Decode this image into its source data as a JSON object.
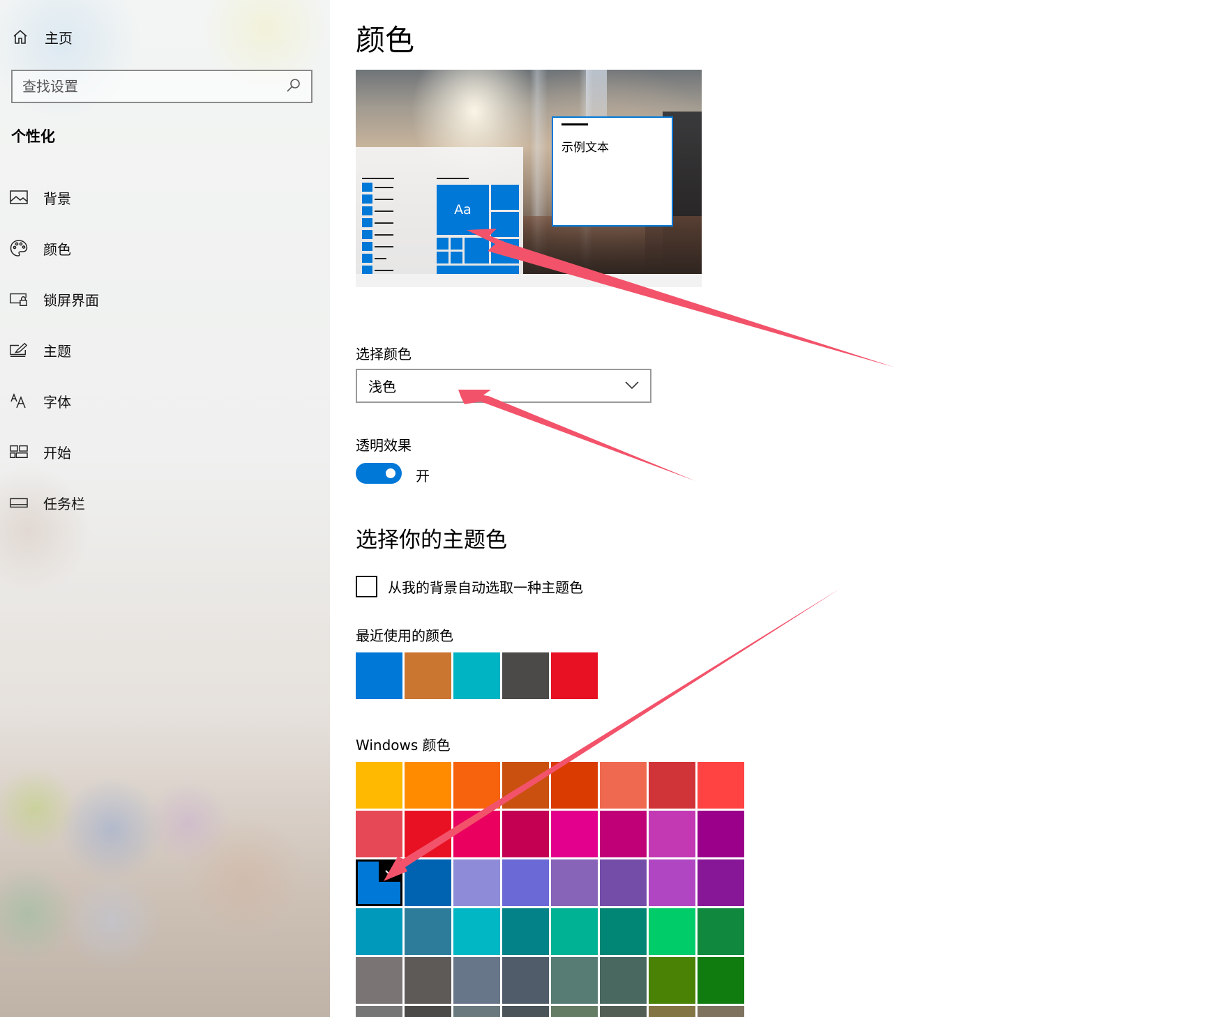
{
  "sidebar": {
    "home_label": "主页",
    "search_placeholder": "查找设置",
    "section_heading": "个性化",
    "items": [
      {
        "label": "背景",
        "icon": "picture-icon"
      },
      {
        "label": "颜色",
        "icon": "palette-icon"
      },
      {
        "label": "锁屏界面",
        "icon": "lock-screen-icon"
      },
      {
        "label": "主题",
        "icon": "theme-brush-icon"
      },
      {
        "label": "字体",
        "icon": "font-icon"
      },
      {
        "label": "开始",
        "icon": "start-tiles-icon"
      },
      {
        "label": "任务栏",
        "icon": "taskbar-icon"
      }
    ]
  },
  "main": {
    "title": "颜色",
    "preview": {
      "tile_label": "Aa",
      "sample_text": "示例文本"
    },
    "choose_color_label": "选择颜色",
    "choose_color_value": "浅色",
    "transparency_label": "透明效果",
    "transparency_state": "开",
    "transparency_on": true,
    "accent_heading": "选择你的主题色",
    "auto_pick_label": "从我的背景自动选取一种主题色",
    "auto_pick_checked": false,
    "recent_colors_label": "最近使用的颜色",
    "recent_colors": [
      "#0078D7",
      "#CA7530",
      "#00B4C3",
      "#4C4A48",
      "#E81123"
    ],
    "windows_colors_label": "Windows 颜色",
    "selected_color": "#0078D7",
    "windows_colors": [
      [
        "#FFB900",
        "#FF8C00",
        "#F7630C",
        "#CA5010",
        "#DA3B01",
        "#EF6950",
        "#D13438",
        "#FF4343"
      ],
      [
        "#E74856",
        "#E81123",
        "#EA005E",
        "#C30052",
        "#E3008C",
        "#BF0077",
        "#C239B3",
        "#9A0089"
      ],
      [
        "#0078D7",
        "#0063B1",
        "#8E8CD8",
        "#6B69D6",
        "#8764B8",
        "#744DA9",
        "#B146C2",
        "#881798"
      ],
      [
        "#0099BC",
        "#2D7D9A",
        "#00B7C3",
        "#038387",
        "#00B294",
        "#018574",
        "#00CC6A",
        "#10893E"
      ],
      [
        "#7A7574",
        "#5D5A58",
        "#68768A",
        "#515C6B",
        "#567C73",
        "#486860",
        "#498205",
        "#107C10"
      ],
      [
        "#767676",
        "#4C4A48",
        "#69797E",
        "#4A5459",
        "#647C64",
        "#525E54",
        "#847545",
        "#7E735F"
      ]
    ],
    "annotation_color": "#F2536A"
  }
}
